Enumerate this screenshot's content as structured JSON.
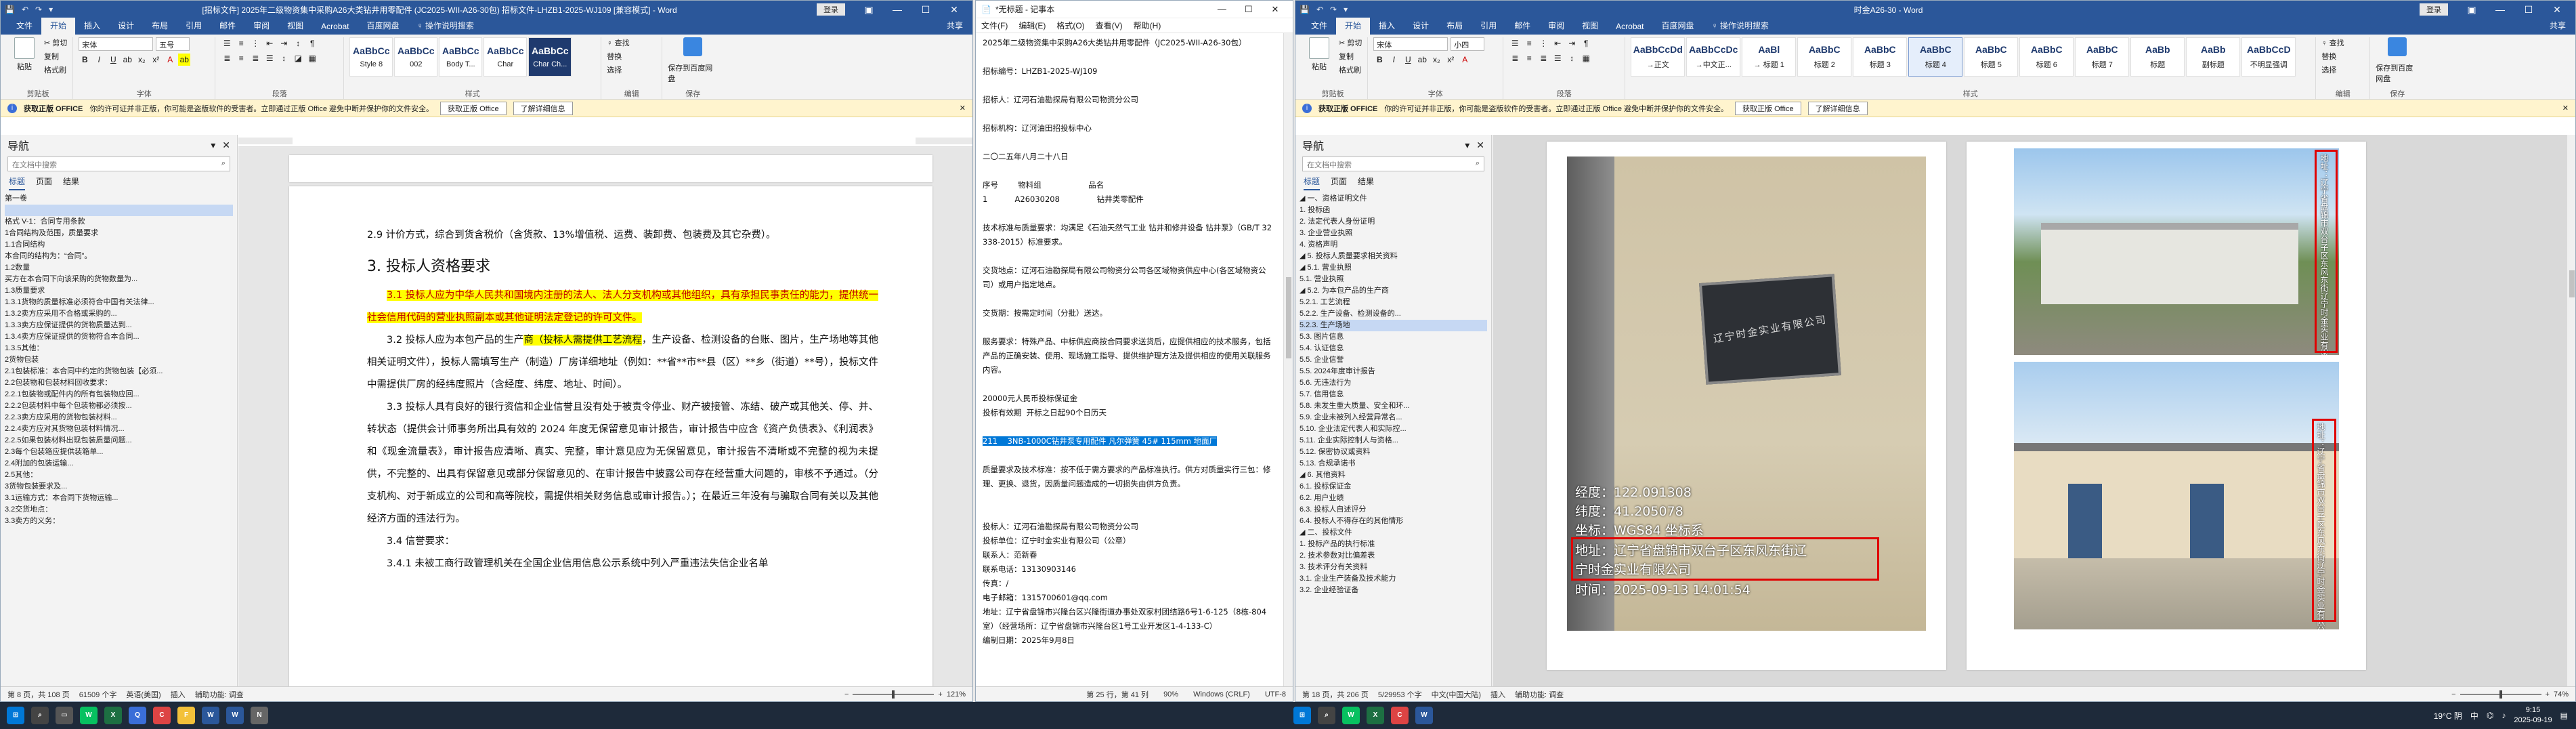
{
  "word_left": {
    "title": "[招标文件] 2025年二级物资集中采购A26大类钻井用零配件 (JC2025-WII-A26-30包) 招标文件-LHZB1-2025-WJ109 [兼容模式] - Word",
    "login": "登录",
    "tabs": [
      "文件",
      "开始",
      "插入",
      "设计",
      "布局",
      "引用",
      "邮件",
      "审阅",
      "视图",
      "Acrobat",
      "百度网盘"
    ],
    "active_tab": "开始",
    "tell": "♀ 操作说明搜索",
    "share": "共享",
    "clipboard": {
      "paste": "粘贴",
      "cut": "✂ 剪切",
      "copy": "复制",
      "painter": "格式刷",
      "label": "剪贴板"
    },
    "font": {
      "name": "宋体",
      "size": "五号",
      "label": "字体"
    },
    "paragraph_label": "段落",
    "styles": [
      {
        "sample": "AaBbCc",
        "name": "Style 8"
      },
      {
        "sample": "AaBbCc",
        "name": "002"
      },
      {
        "sample": "AaBbCc",
        "name": "Body T..."
      },
      {
        "sample": "AaBbCc",
        "name": "Char"
      },
      {
        "sample": "AaBbCc",
        "name": "Char Ch..."
      }
    ],
    "styles_label": "样式",
    "editing": {
      "find": "♀ 查找",
      "replace": "替换",
      "select": "选择",
      "label": "编辑"
    },
    "save_baidu": "保存到百度网盘",
    "save_label": "保存",
    "infobar": {
      "title": "获取正版 OFFICE",
      "text": "你的许可证并非正版，你可能是盗版软件的受害者。立即通过正版 Office 避免中断并保护你的文件安全。",
      "btn1": "获取正版 Office",
      "btn2": "了解详细信息"
    },
    "nav": {
      "title": "导航",
      "search_placeholder": "在文档中搜索",
      "tabs": [
        "标题",
        "页面",
        "结果"
      ],
      "items": [
        "第一卷",
        "",
        "格式 V-1：合同专用条款",
        "1合同结构及范围，质量要求",
        "1.1合同结构",
        "本合同的结构为：“合同”。",
        "1.2数量",
        "买方在本合同下向该采购的货物数量为...",
        "1.3质量要求",
        "1.3.1货物的质量标准必须符合中国有关法律...",
        "1.3.2卖方应采用不合格或采购的...",
        "1.3.3卖方应保证提供的货物质量达到...",
        "1.3.4卖方应保证提供的货物符合本合同...",
        "1.3.5其他：",
        "2货物包装",
        "2.1包装标准：本合同中约定的货物包装【必须...",
        "2.2包装物和包装材料回收要求：",
        "2.2.1包装物或配件内的所有包装物应回...",
        "2.2.2包装材料中每个包装物都必须按...",
        "2.2.3卖方应采用的货物包装材料...",
        "2.2.4卖方应对其货物包装材料情况...",
        "2.2.5如果包装材料出现包装质量问题...",
        "2.3每个包装箱应提供装箱单...",
        "2.4附加的包装运输...",
        "2.5其他：",
        "3货物包装要求及...",
        "3.1运输方式：本合同下货物运输...",
        "3.2交货地点：",
        "3.3卖方的义务："
      ],
      "highlight_index": 1
    },
    "doc": {
      "line1": "2.9 计价方式，综合到货含税价（含货款、13%增值税、运费、装卸费、包装费及其它杂费）。",
      "heading": "3.  投标人资格要求",
      "p1": "3.1 投标人应为中华人民共和国境内注册的法人、法人分支机构或其他组织，具有承担民事责任的能力，提供统一社会信用代码的营业执照副本或其他证明法定登记的许可文件。",
      "p2a": "3.2 投标人应为本包产品的生产",
      "p2b": "商（投标人需提供工艺流程",
      "p2c": "，生产设备、检测设备的台账、图片，生产场地等其他相关证明文件），投标人需填写生产（制造）厂房详细地址（例如：**省**市**县（区）**乡（街道）**号），投标文件中需提供厂房的经纬度照片（含经度、纬度、地址、时间）。",
      "p3": "3.3 投标人具有良好的银行资信和企业信誉且没有处于被责令停业、财产被接管、冻结、破产或其他关、停、并、转状态（提供会计师事务所出具有效的 2024 年度无保留意见审计报告，审计报告中应含《资产负债表》、《利润表》和《现金流量表》，审计报告应清晰、真实、完整，审计意见应为无保留意见，审计报告不清晰或不完整的视为未提供，不完整的、出具有保留意见或部分保留意见的、在审计报告中披露公司存在经营重大问题的，审核不予通过。（分支机构、对于新成立的公司和高等院校，需提供相关财务信息或审计报告。）；在最近三年没有与骗取合同有关以及其他经济方面的违法行为。",
      "p4": "3.4 信誉要求：",
      "p5": "3.4.1 未被工商行政管理机关在全国企业信用信息公示系统中列入严重违法失信企业名单"
    },
    "status": {
      "page": "第 8 页，共 108 页",
      "words": "61509 个字",
      "lang": "英语(美国)",
      "insert": "插入",
      "a11y": "辅助功能: 调查",
      "zoom": "121%"
    }
  },
  "notepad": {
    "title": "*无标题 - 记事本",
    "menu": [
      "文件(F)",
      "编辑(E)",
      "格式(O)",
      "查看(V)",
      "帮助(H)"
    ],
    "lines": [
      "2025年二级物资集中采购A26大类钻井用零配件（JC2025-WII-A26-30包）",
      "",
      "招标编号：LHZB1-2025-WJ109",
      "",
      "招标人：辽河石油勘探局有限公司物资分公司",
      "",
      "招标机构：辽河油田招投标中心",
      "",
      "二〇二五年八月二十八日",
      "",
      "序号        物料组                   品名",
      "1           A26030208               钻井类零配件",
      "",
      "技术标准与质量要求：均满足《石油天然气工业 钻井和修井设备 钻井泵》（GB/T 32338-2015）标准要求。",
      "",
      "交货地点：辽河石油勘探局有限公司物资分公司各区域物资供应中心(各区域物资公司）或用户指定地点。",
      "",
      "交货期：按需定时间（分批）送达。",
      "",
      "服务要求：特殊产品、中标供应商按合同要求送货后，应提供相应的技术服务，包括产品的正确安装、使用、现场施工指导、提供维护理方法及提供相应的使用关联服务内容。",
      "",
      "20000元人民币投标保证金",
      "投标有效期  开标之日起90个日历天",
      "",
      "",
      "质量要求及技术标准：按不低于需方要求的产品标准执行。供方对质量实行三包：修理、更换、退货，因质量问题造成的一切损失由供方负责。",
      "",
      "",
      "投标人：辽河石油勘探局有限公司物资分公司",
      "投标单位：辽宁时金实业有限公司（公章）",
      "联系人：范新春",
      "联系电话：13130903146",
      "传真：/",
      "电子邮箱：1315700601@qq.com",
      "地址：辽宁省盘锦市兴隆台区兴隆街道办事处双家村团结路6号1-6-125（8栋-804室）（经营场所：辽宁省盘锦市兴隆台区1号工业开发区1-4-133-C）",
      "编制日期：2025年9月8日"
    ],
    "selected_line": "211    3NB-1000C钻井泵专用配件 凡尔弹簧 45# 115mm 地面厂",
    "selected_after_index": 23,
    "status": {
      "pos": "第 25 行，第 41 列",
      "zoom": "90%",
      "eol": "Windows (CRLF)",
      "enc": "UTF-8"
    }
  },
  "word_right": {
    "title": "时金A26-30 - Word",
    "login": "登录",
    "tabs": [
      "文件",
      "开始",
      "插入",
      "设计",
      "布局",
      "引用",
      "邮件",
      "审阅",
      "视图",
      "Acrobat",
      "百度网盘"
    ],
    "active_tab": "开始",
    "tell": "♀ 操作说明搜索",
    "share": "共享",
    "font": {
      "name": "宋体",
      "size": "小四"
    },
    "styles": [
      {
        "sample": "AaBbCcDd",
        "name": "→正文"
      },
      {
        "sample": "AaBbCcDc",
        "name": "→中文正..."
      },
      {
        "sample": "AaBl",
        "name": "→ 标题 1"
      },
      {
        "sample": "AaBbC",
        "name": "标题 2"
      },
      {
        "sample": "AaBbC",
        "name": "标题 3"
      },
      {
        "sample": "AaBbC",
        "name": "标题 4"
      },
      {
        "sample": "AaBbC",
        "name": "标题 5"
      },
      {
        "sample": "AaBbC",
        "name": "标题 6"
      },
      {
        "sample": "AaBbC",
        "name": "标题 7"
      },
      {
        "sample": "AaBb",
        "name": "标题"
      },
      {
        "sample": "AaBb",
        "name": "副标题"
      },
      {
        "sample": "AaBbCcD",
        "name": "不明显强调"
      }
    ],
    "editing": {
      "find": "♀ 查找",
      "replace": "替换",
      "select": "选择",
      "label": "编辑"
    },
    "save_baidu": "保存到百度网盘",
    "infobar": {
      "title": "获取正版 OFFICE",
      "text": "你的许可证并非正版，你可能是盗版软件的受害者。立即通过正版 Office 避免中断并保护你的文件安全。",
      "btn1": "获取正版 Office",
      "btn2": "了解详细信息"
    },
    "nav": {
      "title": "导航",
      "search_placeholder": "在文档中搜索",
      "tabs": [
        "标题",
        "页面",
        "结果"
      ],
      "items": [
        "◢  一、资格证明文件",
        "      1. 投标函",
        "      2. 法定代表人身份证明",
        "      3. 企业营业执照",
        "      4. 资格声明",
        "  ◢  5. 投标人质量要求相关资料",
        "      ◢  5.1. 营业执照",
        "          5.1. 营业执照",
        "      ◢  5.2. 为本包产品的生产商",
        "              5.2.1. 工艺流程",
        "              5.2.2. 生产设备、检测设备的...",
        "              5.2.3. 生产场地",
        "      5.3. 图片信息",
        "      5.4. 认证信息",
        "      5.5. 企业信誉",
        "      5.5. 2024年度审计报告",
        "      5.6. 无违法行为",
        "      5.7. 信用信息",
        "      5.8. 未发生重大质量、安全和环...",
        "      5.9. 企业未被列入经营异常名...",
        "      5.10. 企业法定代表人和实际控...",
        "      5.11. 企业实际控制人与资格...",
        "      5.12. 保密协议或资料",
        "      5.13. 合规承诺书",
        "  ◢  6. 其他资料",
        "      6.1. 投标保证金",
        "      6.2. 用户业绩",
        "      6.3. 投标人自述评分",
        "      6.4. 投标人不得存在的其他情形",
        "◢  二、投标文件",
        "      1. 投标产品的执行标准",
        "      2. 技术参数对比偏差表",
        "      3. 技术评分有关资料",
        "      3.1. 企业生产装备及技术能力",
        "      3.2. 企业经验证备"
      ],
      "highlight_index": 11
    },
    "photo1": {
      "sign_text": "辽宁时金实业有限公司",
      "lng": "经度：122.091308",
      "lat": "纬度：41.205078",
      "coord": "坐标：WGS84 坐标系",
      "addr1": "地址：辽宁省盘锦市双台子区东风东街辽",
      "addr2": "宁时金实业有限公司",
      "time": "时间：2025-09-13 14:01:54"
    },
    "photo2": {
      "vtext": "地址：辽宁省盘锦市双台子区东风东街辽宁时金实业有限公司"
    },
    "photo3": {
      "vtext": "地址：辽宁省盘锦市双台子区东风东街辽宁时金实业有限公司"
    },
    "status": {
      "page": "第 18 页，共 206 页",
      "words": "5/29953 个字",
      "lang": "中文(中国大陆)",
      "insert": "插入",
      "a11y": "辅助功能: 调查",
      "zoom": "74%"
    }
  },
  "taskbar": {
    "weather": "19°C 阴",
    "lang": "中",
    "time": "9:15",
    "date": "2025-09-19",
    "time2": "9:15",
    "date2": "2025-09-19"
  }
}
